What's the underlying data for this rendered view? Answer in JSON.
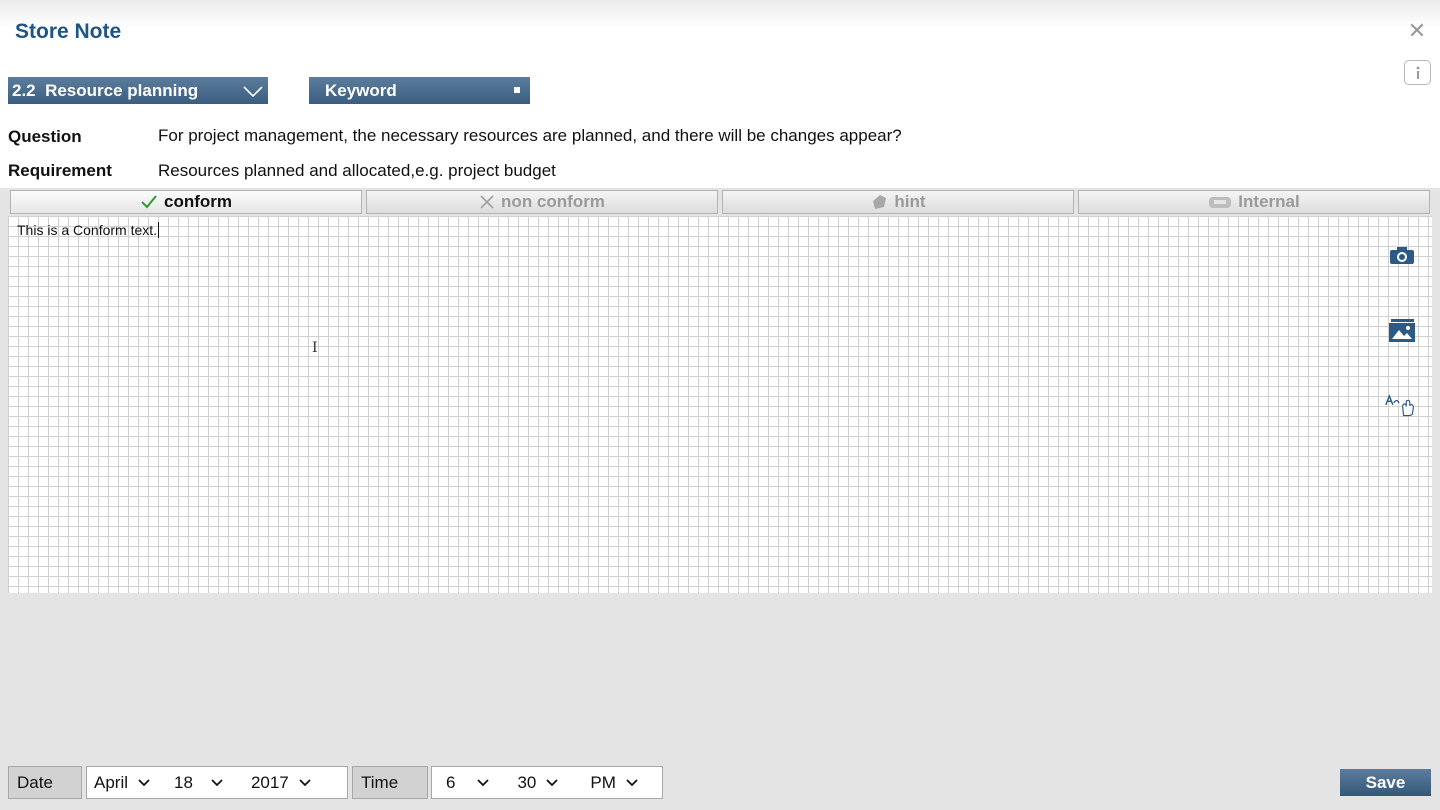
{
  "window": {
    "title": "Store Note"
  },
  "selectors": {
    "section_label": "2.2  Resource planning",
    "keyword_label": "Keyword"
  },
  "question": {
    "label": "Question",
    "value": "For project management, the necessary resources are planned, and there will be changes appear?"
  },
  "requirement": {
    "label": "Requirement",
    "value": "Resources planned and allocated,e.g. project budget"
  },
  "tabs": [
    {
      "label": "conform",
      "icon": "checkmark-icon",
      "active": true
    },
    {
      "label": "non conform",
      "icon": "cross-icon",
      "active": false
    },
    {
      "label": "hint",
      "icon": "hint-icon",
      "active": false
    },
    {
      "label": "Internal",
      "icon": "internal-icon",
      "active": false
    }
  ],
  "editor": {
    "text": "This is a Conform text."
  },
  "side_tools": [
    "camera-icon",
    "image-gallery-icon",
    "handwriting-icon"
  ],
  "date": {
    "label": "Date",
    "month": "April",
    "day": "18",
    "year": "2017"
  },
  "time": {
    "label": "Time",
    "hour": "6",
    "minute": "30",
    "ampm": "PM"
  },
  "save_label": "Save",
  "colors": {
    "accent": "#3a5d80",
    "title": "#1e5584",
    "check": "#2e9a2e"
  }
}
